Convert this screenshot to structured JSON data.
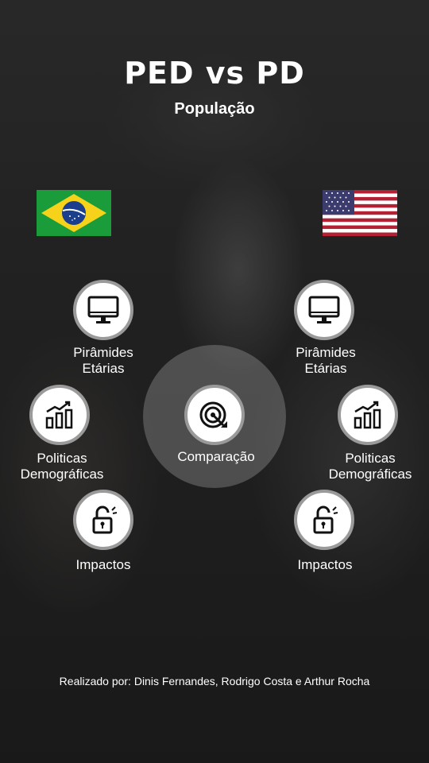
{
  "header": {
    "title": "PED vs PD",
    "subtitle": "População"
  },
  "left": {
    "flag": "brazil-flag",
    "items": [
      {
        "label": "Pirâmides\nEtárias",
        "icon": "monitor-icon"
      },
      {
        "label": "Politicas\nDemográficas",
        "icon": "bar-chart-icon"
      },
      {
        "label": "Impactos",
        "icon": "unlock-icon"
      }
    ]
  },
  "right": {
    "flag": "usa-flag",
    "items": [
      {
        "label": "Pirâmides\nEtárias",
        "icon": "monitor-icon"
      },
      {
        "label": "Politicas\nDemográficas",
        "icon": "bar-chart-icon"
      },
      {
        "label": "Impactos",
        "icon": "unlock-icon"
      }
    ]
  },
  "center": {
    "label": "Comparação",
    "icon": "target-icon"
  },
  "footer": {
    "credits": "Realizado por: Dinis Fernandes, Rodrigo Costa e Arthur Rocha"
  },
  "colors": {
    "node_border": "#9a9a9a",
    "text": "#ffffff"
  }
}
